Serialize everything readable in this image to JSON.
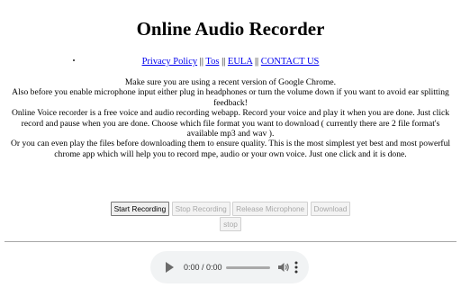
{
  "page": {
    "title": "Online Audio Recorder"
  },
  "links": {
    "privacy": "Privacy Policy",
    "tos": "Tos",
    "eula": "EULA",
    "contact": "CONTACT US",
    "separator": "||"
  },
  "intro": {
    "line1": "Make sure you are using a recent version of Google Chrome.",
    "line2": "Also before you enable microphone input either plug in headphones or turn the volume down if you want to avoid ear splitting feedback!",
    "line3": "Online Voice recorder is a free voice and audio recording webapp. Record your voice and play it when you are done. Just click record and pause when you are done. Choose which file format you want to download ( currently there are 2 file format's available mp3 and wav ).",
    "line4": "Or you can even play the files before downloading them to ensure quality. This is the most simplest yet best and most powerful chrome app which will help you to record mpe, audio or your own voice. Just one click and it is done."
  },
  "controls": {
    "start_recording": "Start Recording",
    "stop_recording": "Stop Recording",
    "release_microphone": "Release Microphone",
    "download": "Download",
    "stop": "stop"
  },
  "player": {
    "time": "0:00 / 0:00",
    "progress": 0,
    "play_icon": "play-icon",
    "volume_icon": "volume-icon",
    "menu_icon": "more-vertical-icon"
  }
}
